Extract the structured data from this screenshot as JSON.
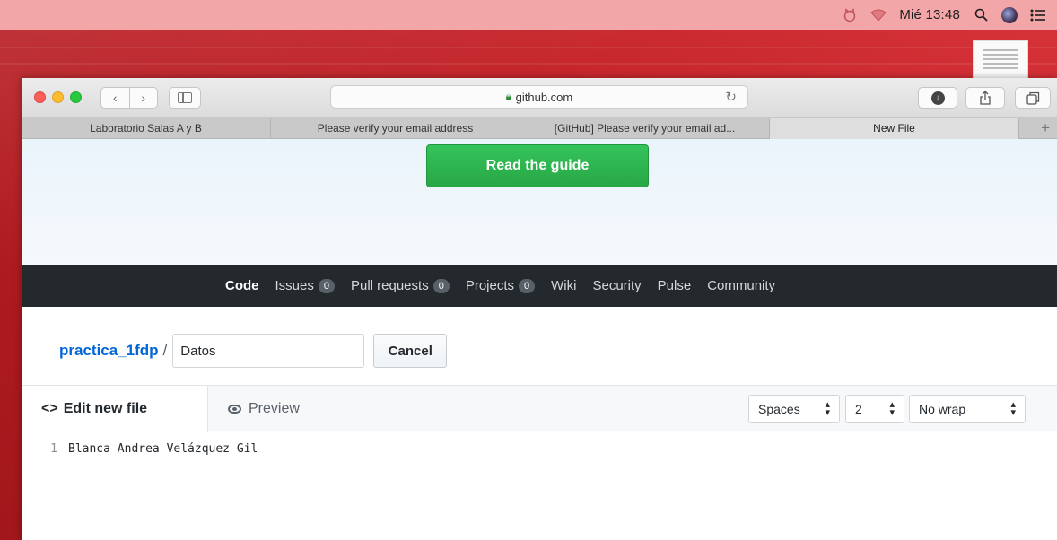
{
  "menubar": {
    "clock": "Mié 13:48"
  },
  "browser": {
    "address": "github.com",
    "tabs": [
      {
        "label": "Laboratorio Salas A y B"
      },
      {
        "label": "Please verify your email address"
      },
      {
        "label": "[GitHub] Please verify your email ad..."
      },
      {
        "label": "New File"
      }
    ],
    "new_tab_symbol": "+"
  },
  "banner": {
    "guide_button": "Read the guide"
  },
  "repo_nav": {
    "items": [
      {
        "label": "Code"
      },
      {
        "label": "Issues",
        "count": "0"
      },
      {
        "label": "Pull requests",
        "count": "0"
      },
      {
        "label": "Projects",
        "count": "0"
      },
      {
        "label": "Wiki"
      },
      {
        "label": "Security"
      },
      {
        "label": "Pulse"
      },
      {
        "label": "Community"
      }
    ]
  },
  "path": {
    "repo": "practica_1fdp",
    "separator": "/",
    "filename_value": "Datos",
    "cancel": "Cancel"
  },
  "editor": {
    "edit_tab": "Edit new file",
    "preview_tab": "Preview",
    "indent_mode": "Spaces",
    "indent_size": "2",
    "wrap_mode": "No wrap",
    "lines": [
      {
        "number": "1",
        "text": "Blanca Andrea Velázquez Gil"
      }
    ]
  },
  "colors": {
    "accent_green": "#28a745",
    "link_blue": "#0366d6",
    "nav_dark": "#24292e"
  }
}
